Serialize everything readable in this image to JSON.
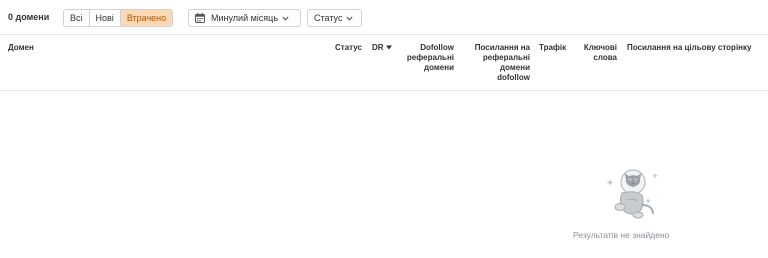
{
  "toolbar": {
    "count_label": "0 домени",
    "filter_tabs": [
      {
        "label": "Всі",
        "active": false
      },
      {
        "label": "Нові",
        "active": false
      },
      {
        "label": "Втрачено",
        "active": true
      }
    ],
    "period_dropdown": {
      "label": "Минулий місяць",
      "icon": "calendar-icon"
    },
    "status_dropdown": {
      "label": "Статус"
    }
  },
  "table": {
    "headers": {
      "domain": "Домен",
      "status": "Статус",
      "dr": "DR",
      "dofollow_ref_domains": [
        "Dofollow",
        "реферальні",
        "домени"
      ],
      "dofollow_links": [
        "Посилання на",
        "реферальні",
        "домени",
        "dofollow"
      ],
      "traffic": "Трафік",
      "keywords": [
        "Ключові",
        "слова"
      ],
      "target_links": "Посилання на цільову сторінку"
    },
    "sorted_column": "dr",
    "sort_direction": "desc"
  },
  "empty_state": {
    "message": "Результатів не знайдено",
    "icon": "astronaut-cat-illustration"
  },
  "colors": {
    "active_tab_bg": "#fcd9b3",
    "active_tab_text": "#a65a11",
    "border": "#cfd3d8"
  }
}
